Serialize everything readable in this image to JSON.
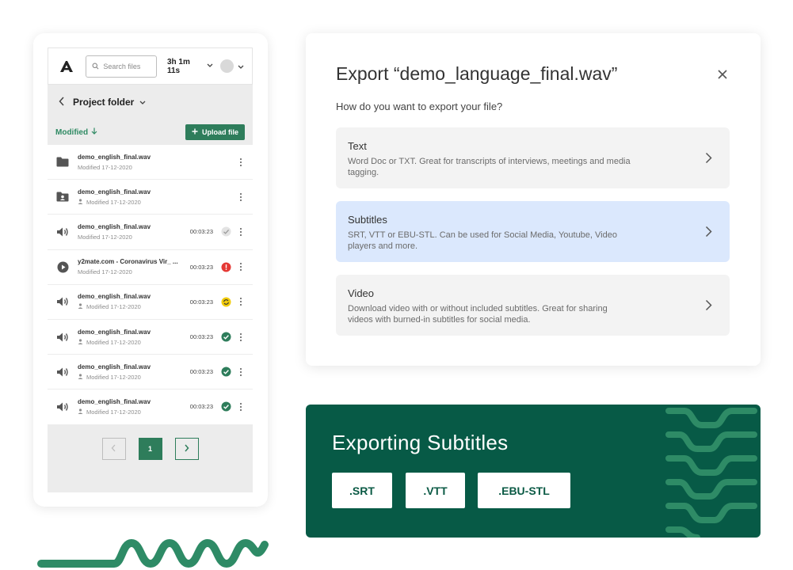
{
  "colors": {
    "brand_green": "#2e7d5b",
    "dark_green": "#075a46",
    "selected_bg": "#dbe8fd",
    "option_bg": "#f3f3f3",
    "error_red": "#e53935",
    "processing_yellow": "#f2cc0c"
  },
  "app": {
    "logo_icon": "brand-a-logo",
    "search_placeholder": "Search files",
    "credits": "3h 1m 11s",
    "folder_title": "Project folder",
    "sort_label": "Modified",
    "upload_label": "Upload file"
  },
  "files": [
    {
      "icon": "folder-icon",
      "name": "demo_english_final.wav",
      "modified": "Modified 17-12-2020",
      "shared": false,
      "duration": "",
      "status": "none"
    },
    {
      "icon": "shared-folder-icon",
      "name": "demo_english_final.wav",
      "modified": "Modified 17-12-2020",
      "shared": true,
      "duration": "",
      "status": "none"
    },
    {
      "icon": "speaker-icon",
      "name": "demo_english_final.wav",
      "modified": "Modified 17-12-2020",
      "shared": false,
      "duration": "00:03:23",
      "status": "pending"
    },
    {
      "icon": "play-icon",
      "name": "y2mate.com - Coronavirus Vir_ ...",
      "modified": "Modified 17-12-2020",
      "shared": false,
      "duration": "00:03:23",
      "status": "error"
    },
    {
      "icon": "speaker-icon",
      "name": "demo_english_final.wav",
      "modified": "Modified 17-12-2020",
      "shared": true,
      "duration": "00:03:23",
      "status": "processing"
    },
    {
      "icon": "speaker-icon",
      "name": "demo_english_final.wav",
      "modified": "Modified 17-12-2020",
      "shared": true,
      "duration": "00:03:23",
      "status": "done"
    },
    {
      "icon": "speaker-icon",
      "name": "demo_english_final.wav",
      "modified": "Modified 17-12-2020",
      "shared": true,
      "duration": "00:03:23",
      "status": "done"
    },
    {
      "icon": "speaker-icon",
      "name": "demo_english_final.wav",
      "modified": "Modified 17-12-2020",
      "shared": true,
      "duration": "00:03:23",
      "status": "done"
    }
  ],
  "pagination": {
    "current": "1"
  },
  "dialog": {
    "title": "Export “demo_language_final.wav”",
    "subtitle": "How do you want to export your file?",
    "options": [
      {
        "title": "Text",
        "description": "Word Doc or TXT. Great for transcripts of interviews, meetings and media tagging.",
        "selected": false
      },
      {
        "title": "Subtitles",
        "description": "SRT, VTT or EBU-STL. Can be used for Social Media, Youtube, Video players and more.",
        "selected": true
      },
      {
        "title": "Video",
        "description": "Download video with or without included subtitles. Great for sharing videos with burned-in subtitles for social media.",
        "selected": false
      }
    ]
  },
  "exporting": {
    "title": "Exporting Subtitles",
    "formats": [
      ".SRT",
      ".VTT",
      ".EBU-STL"
    ]
  }
}
